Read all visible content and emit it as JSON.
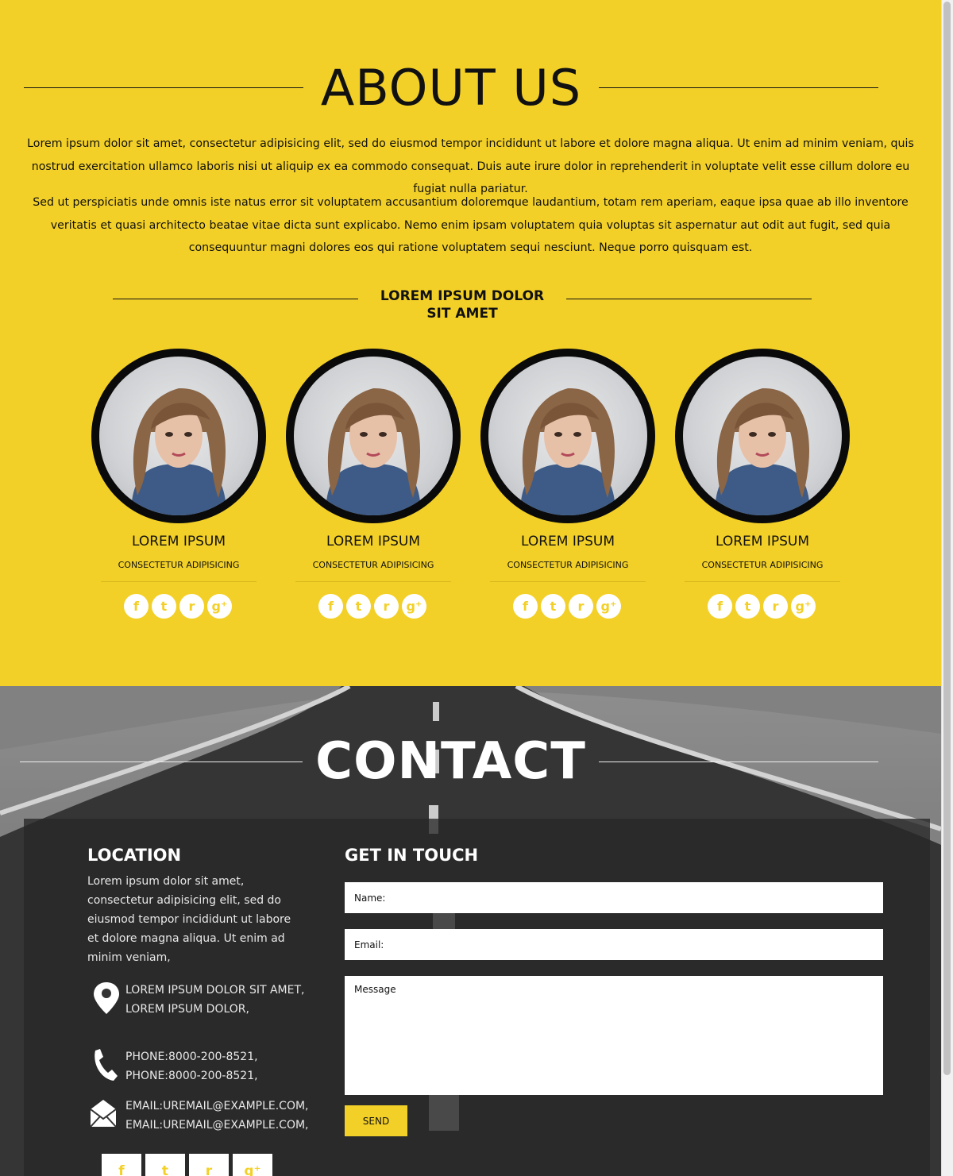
{
  "about": {
    "title": "ABOUT US",
    "paragraph1": "Lorem ipsum dolor sit amet, consectetur adipisicing elit, sed do eiusmod tempor incididunt ut labore et dolore magna aliqua. Ut enim ad minim veniam, quis nostrud exercitation ullamco laboris nisi ut aliquip ex ea commodo consequat. Duis aute irure dolor in reprehenderit in voluptate velit esse cillum dolore eu fugiat nulla pariatur.",
    "paragraph2": "Sed ut perspiciatis unde omnis iste natus error sit voluptatem accusantium doloremque laudantium, totam rem aperiam, eaque ipsa quae ab illo inventore veritatis et quasi architecto beatae vitae dicta sunt explicabo. Nemo enim ipsam voluptatem quia voluptas sit aspernatur aut odit aut fugit, sed quia consequuntur magni dolores eos qui ratione voluptatem sequi nesciunt. Neque porro quisquam est.",
    "team_heading": "LOREM IPSUM DOLOR SIT AMET",
    "members": [
      {
        "name": "LOREM IPSUM",
        "role": "CONSECTETUR ADIPISICING"
      },
      {
        "name": "LOREM IPSUM",
        "role": "CONSECTETUR ADIPISICING"
      },
      {
        "name": "LOREM IPSUM",
        "role": "CONSECTETUR ADIPISICING"
      },
      {
        "name": "LOREM IPSUM",
        "role": "CONSECTETUR ADIPISICING"
      }
    ],
    "social_icons": [
      "facebook-icon",
      "twitter-icon",
      "rss-icon",
      "google-plus-icon"
    ],
    "social_glyphs": [
      "f",
      "t",
      "r",
      "g⁺"
    ]
  },
  "contact": {
    "title": "CONTACT",
    "location_title": "LOCATION",
    "location_text": "Lorem ipsum dolor sit amet, consectetur adipisicing elit, sed do eiusmod tempor incididunt ut labore et dolore magna aliqua. Ut enim ad minim veniam,",
    "address_line1": "LOREM IPSUM DOLOR SIT AMET,",
    "address_line2": "LOREM IPSUM DOLOR,",
    "phone_line1": "PHONE:8000-200-8521,",
    "phone_line2": "PHONE:8000-200-8521,",
    "email_line1": "EMAIL:UREMAIL@EXAMPLE.COM,",
    "email_line2": "EMAIL:UREMAIL@EXAMPLE.COM,",
    "get_in_touch_title": "GET IN TOUCH",
    "name_placeholder": "Name:",
    "email_placeholder": "Email:",
    "message_placeholder": "Message",
    "send_label": "SEND"
  },
  "colors": {
    "accent": "#f3d027",
    "dark": "#111111",
    "panel": "#282828"
  }
}
